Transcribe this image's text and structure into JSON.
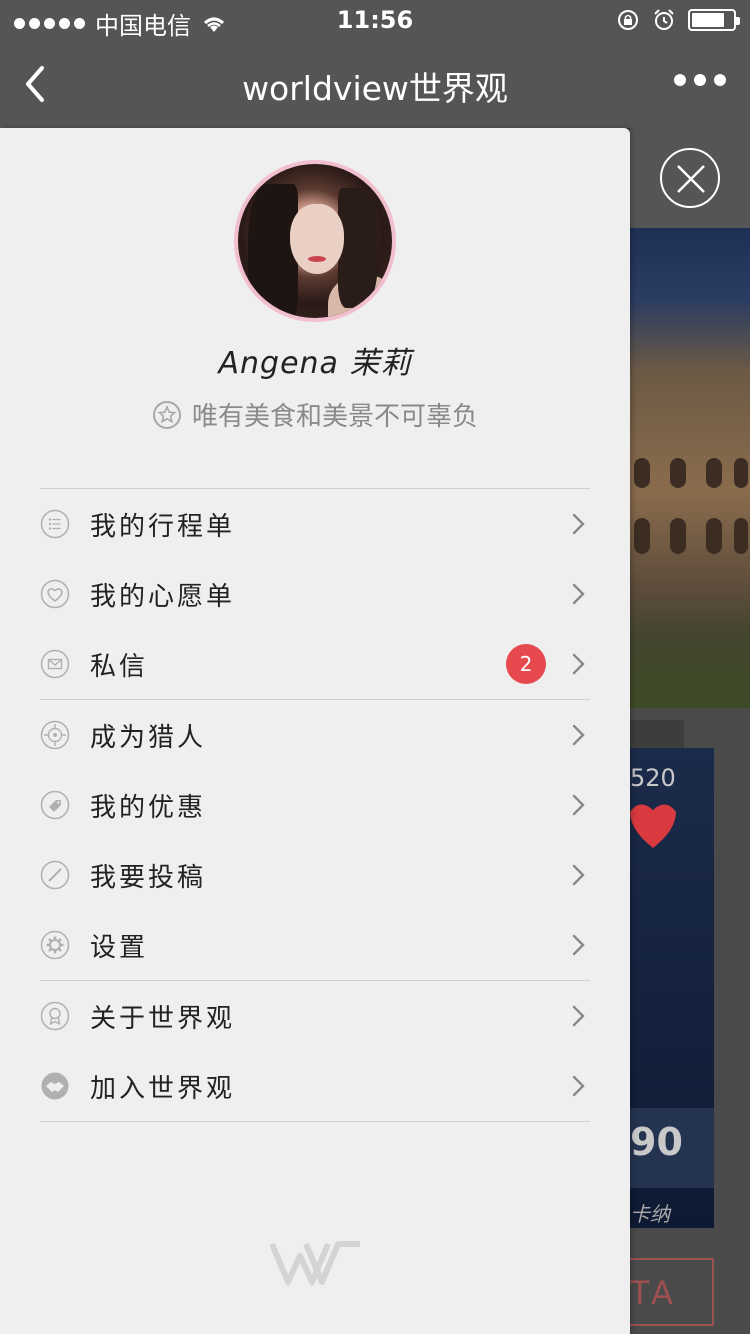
{
  "status_bar": {
    "carrier": "中国电信",
    "time": "11:56"
  },
  "nav": {
    "title": "worldview世界观",
    "back_icon": "chevron-left-icon",
    "more_icon": "more-dots-icon"
  },
  "profile": {
    "name": "Angena 茉莉",
    "motto": "唯有美食和美景不可辜负"
  },
  "menu": {
    "items": [
      {
        "label": "我的行程单",
        "icon": "list-icon"
      },
      {
        "label": "我的心愿单",
        "icon": "heart-icon"
      },
      {
        "label": "私信",
        "icon": "mail-icon",
        "badge": "2"
      },
      {
        "label": "成为猎人",
        "icon": "target-icon"
      },
      {
        "label": "我的优惠",
        "icon": "tag-icon"
      },
      {
        "label": "我要投稿",
        "icon": "pencil-icon"
      },
      {
        "label": "设置",
        "icon": "gear-icon"
      },
      {
        "label": "关于世界观",
        "icon": "award-icon"
      },
      {
        "label": "加入世界观",
        "icon": "handshake-icon"
      }
    ]
  },
  "background": {
    "count": "520",
    "price": "90",
    "subtitle": "卡纳",
    "button": "TA"
  },
  "colors": {
    "bar": "#555555",
    "drawer": "#efefef",
    "badge": "#e64a4f",
    "avatar_ring": "#f2bfcf"
  }
}
